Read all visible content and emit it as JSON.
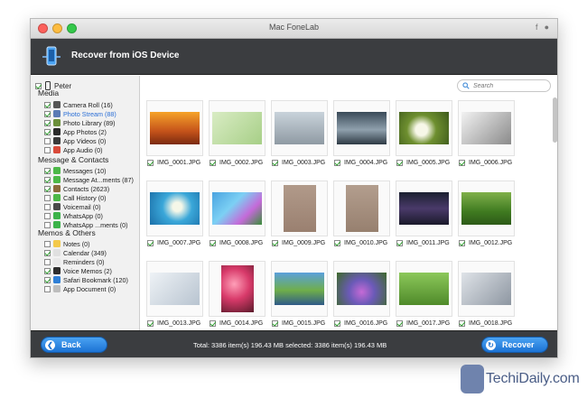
{
  "window": {
    "title": "Mac FoneLab",
    "social_icons": [
      "facebook-icon",
      "chat-icon"
    ]
  },
  "header": {
    "title": "Recover from iOS Device"
  },
  "sidebar": {
    "device": {
      "name": "Peter",
      "checked": true
    },
    "sections": [
      {
        "title": "Media",
        "items": [
          {
            "label": "Camera Roll (16)",
            "checked": true,
            "icon": "camera-icon",
            "color": "#555555"
          },
          {
            "label": "Photo Stream (88)",
            "checked": true,
            "icon": "photo-stream-icon",
            "color": "#5a7ab5",
            "active": true
          },
          {
            "label": "Photo Library (89)",
            "checked": true,
            "icon": "photo-library-icon",
            "color": "#6b8f3a"
          },
          {
            "label": "App Photos (2)",
            "checked": true,
            "icon": "app-photos-icon",
            "color": "#2b2b2b"
          },
          {
            "label": "App Videos (0)",
            "checked": false,
            "icon": "app-videos-icon",
            "color": "#3a3a3a"
          },
          {
            "label": "App Audio (0)",
            "checked": false,
            "icon": "app-audio-icon",
            "color": "#d94a3a"
          }
        ]
      },
      {
        "title": "Message & Contacts",
        "items": [
          {
            "label": "Messages (10)",
            "checked": true,
            "icon": "messages-icon",
            "color": "#4cb848"
          },
          {
            "label": "Message At...ments (87)",
            "checked": true,
            "icon": "attachments-icon",
            "color": "#4cb848"
          },
          {
            "label": "Contacts (2623)",
            "checked": true,
            "icon": "contacts-icon",
            "color": "#8b6a3c"
          },
          {
            "label": "Call History (0)",
            "checked": false,
            "icon": "call-history-icon",
            "color": "#4cb848"
          },
          {
            "label": "Voicemail (0)",
            "checked": false,
            "icon": "voicemail-icon",
            "color": "#4a4a4a"
          },
          {
            "label": "WhatsApp (0)",
            "checked": false,
            "icon": "whatsapp-icon",
            "color": "#3cb34a"
          },
          {
            "label": "WhatsApp ...ments (0)",
            "checked": false,
            "icon": "whatsapp-attachments-icon",
            "color": "#3cb34a"
          }
        ]
      },
      {
        "title": "Memos & Others",
        "items": [
          {
            "label": "Notes (0)",
            "checked": false,
            "icon": "notes-icon",
            "color": "#f3c94a"
          },
          {
            "label": "Calendar (349)",
            "checked": true,
            "icon": "calendar-icon",
            "color": "#e0e0e0"
          },
          {
            "label": "Reminders (0)",
            "checked": false,
            "icon": "reminders-icon",
            "color": "#e8e8e8"
          },
          {
            "label": "Voice Memos (2)",
            "checked": true,
            "icon": "voice-memos-icon",
            "color": "#2d2d2d"
          },
          {
            "label": "Safari Bookmark (120)",
            "checked": true,
            "icon": "safari-icon",
            "color": "#2f7fd6"
          },
          {
            "label": "App Document (0)",
            "checked": false,
            "icon": "app-document-icon",
            "color": "#bdbdbd"
          }
        ]
      }
    ]
  },
  "search": {
    "placeholder": "Search"
  },
  "photos": [
    {
      "name": "IMG_0001.JPG",
      "checked": true,
      "bg": "linear-gradient(180deg,#f6a32a,#c4521a 60%,#7a2a10)",
      "portrait": false
    },
    {
      "name": "IMG_0002.JPG",
      "checked": true,
      "bg": "linear-gradient(135deg,#d9ecc4,#a7cf87)",
      "portrait": false
    },
    {
      "name": "IMG_0003.JPG",
      "checked": true,
      "bg": "linear-gradient(180deg,#c9d3db,#8f9aa3)",
      "portrait": false
    },
    {
      "name": "IMG_0004.JPG",
      "checked": true,
      "bg": "linear-gradient(180deg,#3a4a58,#8fa0ad 55%,#2e3a44)",
      "portrait": false
    },
    {
      "name": "IMG_0005.JPG",
      "checked": true,
      "bg": "radial-gradient(circle at 45% 55%,#f7f7e8 18%,#6e8f2f 45%,#3d5a1c)",
      "portrait": false
    },
    {
      "name": "IMG_0006.JPG",
      "checked": true,
      "bg": "linear-gradient(135deg,#f2f2f2,#8a8a8a)",
      "portrait": false
    },
    {
      "name": "IMG_0007.JPG",
      "checked": true,
      "bg": "radial-gradient(circle at 55% 45%,#f5f7e8 14%,#3aa7d9 45%,#1b6fa8)",
      "portrait": false
    },
    {
      "name": "IMG_0008.JPG",
      "checked": true,
      "bg": "linear-gradient(135deg,#4aa3e0,#7cd0f4 40%,#c46ad8 70%,#3a8e3a)",
      "portrait": false
    },
    {
      "name": "IMG_0009.JPG",
      "checked": true,
      "bg": "linear-gradient(180deg,#b19a8a,#9a8070)",
      "portrait": true
    },
    {
      "name": "IMG_0010.JPG",
      "checked": true,
      "bg": "linear-gradient(180deg,#b39e8e,#97806f)",
      "portrait": true
    },
    {
      "name": "IMG_0011.JPG",
      "checked": true,
      "bg": "linear-gradient(180deg,#1b2030,#4a3a6a 50%,#1a1a2a)",
      "portrait": false
    },
    {
      "name": "IMG_0012.JPG",
      "checked": true,
      "bg": "linear-gradient(180deg,#7fb04a,#3f7a20 60%,#2d5a18)",
      "portrait": false
    },
    {
      "name": "IMG_0013.JPG",
      "checked": true,
      "bg": "linear-gradient(135deg,#eef2f6,#b8c4d0)",
      "portrait": false
    },
    {
      "name": "IMG_0014.JPG",
      "checked": true,
      "bg": "radial-gradient(circle at 40% 40%,#ff9fb8,#d83a6a 45%,#5a1a2a)",
      "portrait": true
    },
    {
      "name": "IMG_0015.JPG",
      "checked": true,
      "bg": "linear-gradient(180deg,#5aa0dc,#6fae4a 55%,#2f5a88)",
      "portrait": false
    },
    {
      "name": "IMG_0016.JPG",
      "checked": true,
      "bg": "radial-gradient(circle at 50% 60%,#c56ad6,#6b5ab8 40%,#3d6a2a)",
      "portrait": false
    },
    {
      "name": "IMG_0017.JPG",
      "checked": true,
      "bg": "linear-gradient(180deg,#8cc85a,#4f8a2a)",
      "portrait": false
    },
    {
      "name": "IMG_0018.JPG",
      "checked": true,
      "bg": "linear-gradient(135deg,#dfe3e8,#8d96a1)",
      "portrait": false
    }
  ],
  "footer": {
    "back_label": "Back",
    "recover_label": "Recover",
    "status": "Total: 3386 item(s) 196.43 MB   selected: 3386 item(s) 196.43 MB"
  },
  "watermark": {
    "text": "TechiDaily.com"
  },
  "colors": {
    "accent": "#1c72d4",
    "header": "#3b3d40",
    "active_item": "#2a6ed6"
  }
}
